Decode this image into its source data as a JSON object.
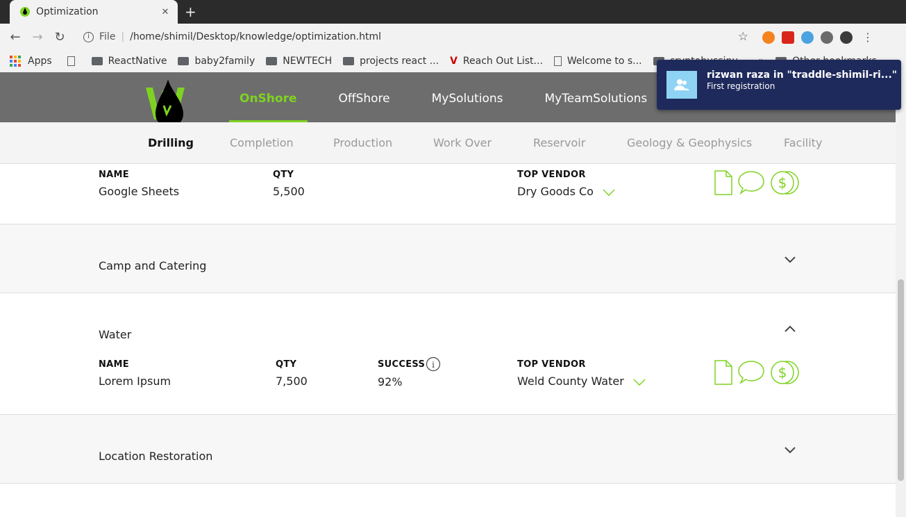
{
  "browser": {
    "tab_title": "Optimization",
    "url_scheme": "File",
    "url": "/home/shimil/Desktop/knowledge/optimization.html",
    "bookmarks": [
      "Apps",
      "ReactNative",
      "baby2family",
      "NEWTECH",
      "projects react ...",
      "Reach Out List...",
      "Welcome to s...",
      "cryptobussinu...",
      "Other bookmarks"
    ]
  },
  "notification": {
    "title": "rizwan raza in \"traddle-shimil-ri...\"",
    "body": "First registration"
  },
  "nav": {
    "items": [
      "OnShore",
      "OffShore",
      "MySolutions",
      "MyTeamSolutions"
    ],
    "active": "OnShore"
  },
  "subnav": {
    "items": [
      "Drilling",
      "Completion",
      "Production",
      "Work Over",
      "Reservoir",
      "Geology & Geophysics",
      "Facility"
    ],
    "active": "Drilling"
  },
  "labels": {
    "name": "NAME",
    "qty": "QTY",
    "success": "SUCCESS",
    "top_vendor": "TOP VENDOR"
  },
  "sections": {
    "first": {
      "name": "Google Sheets",
      "qty": "5,500",
      "vendor": "Dry Goods Co"
    },
    "camp": {
      "title": "Camp and Catering"
    },
    "water": {
      "title": "Water",
      "name": "Lorem Ipsum",
      "qty": "7,500",
      "success": "92%",
      "vendor": "Weld County Water"
    },
    "location": {
      "title": "Location Restoration"
    }
  },
  "colors": {
    "accent": "#7ed321",
    "header": "#6d6d6d",
    "notification": "#1f2a5c"
  }
}
